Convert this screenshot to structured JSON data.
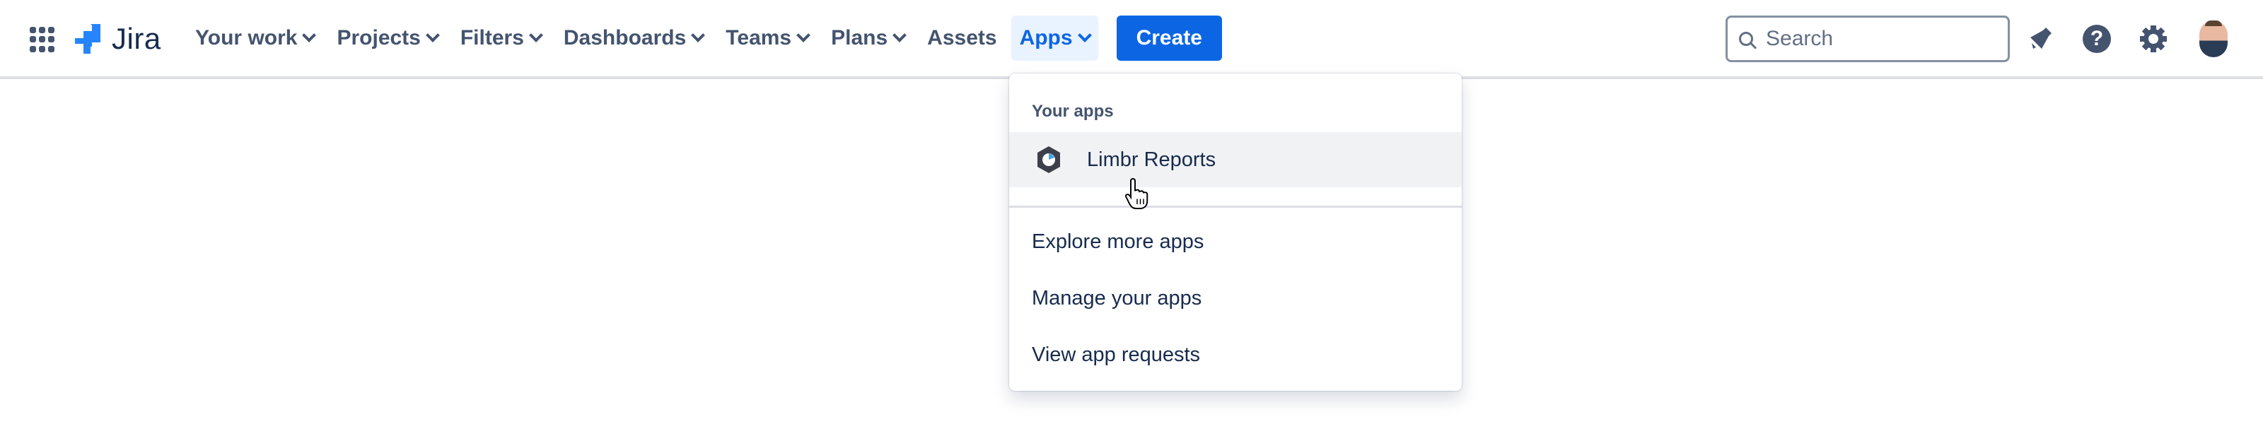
{
  "header": {
    "app_switcher_icon": "grid-icon",
    "logo": {
      "text": "Jira",
      "icon": "jira-logo-icon",
      "color": "#2684ff"
    },
    "nav": [
      {
        "label": "Your work",
        "has_dropdown": true,
        "active": false
      },
      {
        "label": "Projects",
        "has_dropdown": true,
        "active": false
      },
      {
        "label": "Filters",
        "has_dropdown": true,
        "active": false
      },
      {
        "label": "Dashboards",
        "has_dropdown": true,
        "active": false
      },
      {
        "label": "Teams",
        "has_dropdown": true,
        "active": false
      },
      {
        "label": "Plans",
        "has_dropdown": true,
        "active": false
      },
      {
        "label": "Assets",
        "has_dropdown": false,
        "active": false
      },
      {
        "label": "Apps",
        "has_dropdown": true,
        "active": true
      }
    ],
    "create_label": "Create",
    "search": {
      "placeholder": "Search",
      "value": ""
    },
    "icons": [
      "notifications-icon",
      "help-icon",
      "settings-icon",
      "avatar"
    ],
    "accent_color": "#0c66e4"
  },
  "apps_menu": {
    "heading": "Your apps",
    "apps": [
      {
        "label": "Limbr Reports",
        "icon": "limbr-reports-icon",
        "hovered": true
      }
    ],
    "links": [
      {
        "label": "Explore more apps"
      },
      {
        "label": "Manage your apps"
      },
      {
        "label": "View app requests"
      }
    ]
  }
}
